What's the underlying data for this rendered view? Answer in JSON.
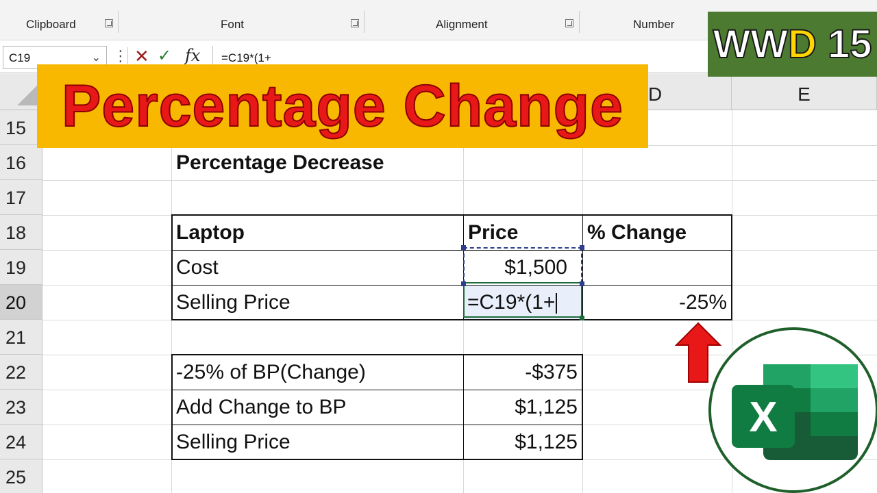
{
  "ribbon": {
    "groups": [
      "Clipboard",
      "Font",
      "Alignment",
      "Number"
    ]
  },
  "formula_bar": {
    "name_box": "C19",
    "cancel_symbol": "✕",
    "enter_symbol": "✓",
    "fx_label": "fx",
    "formula": "=C19*(1+"
  },
  "banner": {
    "title": "Percentage Change",
    "background": "#f8b800",
    "text_color": "#e81818"
  },
  "badge": {
    "prefix": "WW",
    "highlight": "D",
    "number": "15",
    "background": "#4c7a31"
  },
  "sheet": {
    "column_headers": [
      "D",
      "E"
    ],
    "row_headers": [
      "15",
      "16",
      "17",
      "18",
      "19",
      "20",
      "21",
      "22",
      "23",
      "24",
      "25"
    ],
    "active_row": "20",
    "section_title": "Percentage Decrease",
    "table1": {
      "headers": [
        "Laptop",
        "Price",
        "% Change"
      ],
      "rows": [
        {
          "label": "Cost",
          "price": "$1,500",
          "change": ""
        },
        {
          "label": "Selling Price",
          "price_formula": "=C19*(1+",
          "change": "-25%"
        }
      ]
    },
    "table2": {
      "rows": [
        {
          "label": "-25% of BP(Change)",
          "value": "-$375"
        },
        {
          "label": "Add Change to BP",
          "value": "$1,125"
        },
        {
          "label": "Selling Price",
          "value": "$1,125"
        }
      ]
    }
  },
  "decorations": {
    "arrow_color": "#e81818",
    "arrow_icon": "up-arrow-icon",
    "logo_icon": "excel-logo-icon",
    "logo_letter": "X"
  }
}
